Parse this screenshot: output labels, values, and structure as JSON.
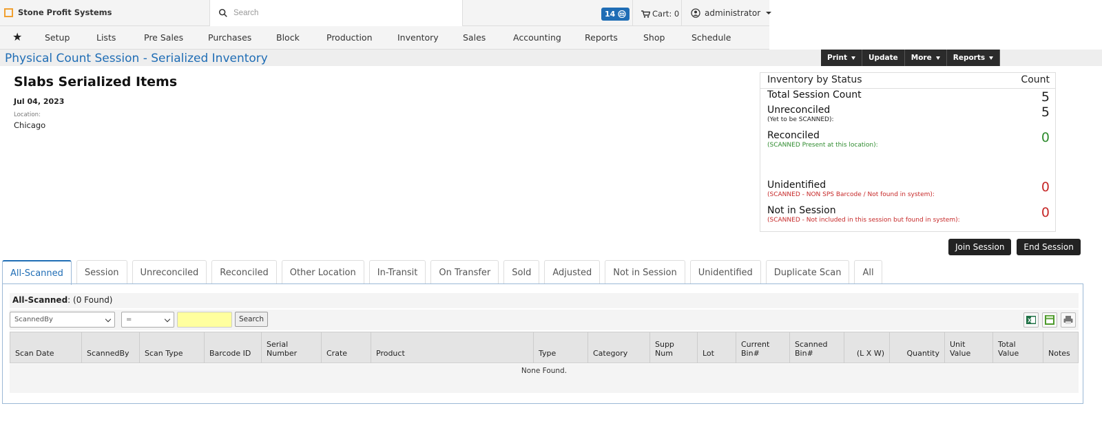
{
  "app": {
    "brand": "Stone Profit Systems"
  },
  "header": {
    "search_placeholder": "Search",
    "message_count": "14",
    "cart_label": "Cart: 0",
    "user_name": "administrator"
  },
  "nav": {
    "items": [
      "Setup",
      "Lists",
      "Pre Sales",
      "Purchases",
      "Block",
      "Production",
      "Inventory",
      "Sales",
      "Accounting",
      "Reports",
      "Shop",
      "Schedule"
    ]
  },
  "page": {
    "title": "Physical Count Session - Serialized Inventory",
    "actions": [
      "Print",
      "Update",
      "More",
      "Reports"
    ]
  },
  "session": {
    "name": "Slabs Serialized Items",
    "date": "Jul 04, 2023",
    "location_label": "Location:",
    "location": "Chicago"
  },
  "status_panel": {
    "header_label": "Inventory by Status",
    "header_count": "Count",
    "rows": [
      {
        "label": "Total Session Count",
        "sub": "",
        "count": "5",
        "color": "#222222"
      },
      {
        "label": "Unreconciled",
        "sub": "(Yet to be SCANNED):",
        "count": "5",
        "color": "#222222"
      },
      {
        "label": "Reconciled",
        "sub": "(SCANNED Present at this location):",
        "count": "0",
        "color": "#2e8b2e"
      },
      {
        "label": "Unidentified",
        "sub": "(SCANNED - NON SPS Barcode / Not found in system):",
        "count": "0",
        "color": "#c62828"
      },
      {
        "label": "Not in Session",
        "sub": "(SCANNED - Not included in this session but found in system):",
        "count": "0",
        "color": "#c62828"
      }
    ],
    "join_label": "Join Session",
    "end_label": "End Session"
  },
  "tabs": [
    "All-Scanned",
    "Session",
    "Unreconciled",
    "Reconciled",
    "Other Location",
    "In-Transit",
    "On Transfer",
    "Sold",
    "Adjusted",
    "Not in Session",
    "Unidentified",
    "Duplicate Scan",
    "All"
  ],
  "active_tab": "All-Scanned",
  "grid": {
    "title": "All-Scanned",
    "found_text": ": (0 Found)",
    "filter_field": "ScannedBy",
    "filter_operator": "=",
    "filter_value": "",
    "search_label": "Search",
    "columns": [
      "Scan Date",
      "ScannedBy",
      "Scan Type",
      "Barcode ID",
      "Serial Number",
      "Crate",
      "Product",
      "Type",
      "Category",
      "Supp Num",
      "Lot",
      "Current Bin#",
      "Scanned Bin#",
      "(L X W)",
      "Quantity",
      "Unit Value",
      "Total Value",
      "Notes"
    ],
    "empty_text": "None Found."
  },
  "colors": {
    "accent": "#1f6db5",
    "dark_button": "#2b2b2b",
    "highlight_input": "#ffff9e"
  }
}
